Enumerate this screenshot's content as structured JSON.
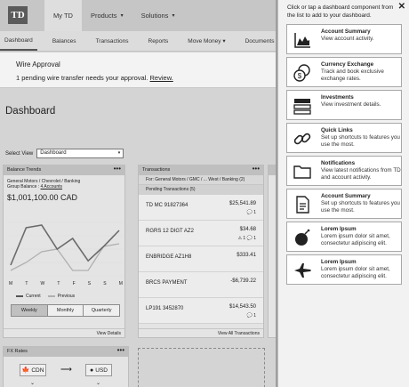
{
  "topbar": {
    "logo": "TD",
    "nav": [
      {
        "label": "My TD",
        "active": true,
        "caret": false
      },
      {
        "label": "Products",
        "active": false,
        "caret": true
      },
      {
        "label": "Solutions",
        "active": false,
        "caret": true
      }
    ],
    "caret_glyph": "▾"
  },
  "subnav": [
    "Dashboard",
    "Balances",
    "Transactions",
    "Reports",
    "Move Money",
    "Documents",
    "A"
  ],
  "move_money_caret": "▾",
  "alert": {
    "title": "Wire Approval",
    "message": "1 pending wire transfer needs your approval.",
    "link": "Review."
  },
  "page_title": "Dashboard",
  "select_view": {
    "label": "Select View",
    "value": "Dashboard"
  },
  "balance_trends": {
    "header": "Balance Trends",
    "account": "General Motors / Chevrolet / Banking",
    "group_prefix": "Group Balance :",
    "group_link": "4 Accounts",
    "balance": "$1,001,100.00 CAD",
    "days": [
      "M",
      "T",
      "W",
      "T",
      "F",
      "S",
      "S",
      "M"
    ],
    "legend_current": "Current",
    "legend_previous": "Previous",
    "tabs": [
      "Weekly",
      "Monthly",
      "Quarterly"
    ],
    "selected_tab": "Weekly",
    "footer": "View Details"
  },
  "transactions": {
    "header": "Transactions",
    "account_line": "For: General Motors / GMC / ... West / Banking (2)",
    "pending": "Pending Transactions (5)",
    "rows": [
      {
        "name": "TD MC 91827364",
        "amount": "$25,541.89",
        "icon": "💬 1"
      },
      {
        "name": "RGRS 12 DIGT AZ2",
        "amount": "$34.68",
        "icon": "⚠ 1 💬 1"
      },
      {
        "name": "ENBRIDGE AZ1H8",
        "amount": "$333.41",
        "icon": ""
      },
      {
        "name": "BRCS PAYMENT",
        "amount": "-$6,739.22",
        "icon": ""
      },
      {
        "name": "LP191 3452870",
        "amount": "$14,543.50",
        "icon": "💬 1"
      }
    ],
    "footer": "View All Transactions"
  },
  "fx_rates": {
    "header": "FX Rates",
    "from": "CDN",
    "to": "USD",
    "arrow": "⟶",
    "chevron": "⌄"
  },
  "sidebar": {
    "intro": "Click or tap a dashboard component from the list to add to your dashboard.",
    "close": "✕",
    "cards": [
      {
        "icon": "chart-icon",
        "title": "Account Summary",
        "desc": "View account activity."
      },
      {
        "icon": "currency-exchange-icon",
        "title": "Currency Exchange",
        "desc": "Track and book exclusive exchange rates."
      },
      {
        "icon": "investments-icon",
        "title": "Investments",
        "desc": "View investment details."
      },
      {
        "icon": "link-icon",
        "title": "Quick Links",
        "desc": "Set up shortcuts to features you use the most."
      },
      {
        "icon": "folder-icon",
        "title": "Notifications",
        "desc": "View latest notifications from TD and account activity."
      },
      {
        "icon": "document-icon",
        "title": "Account Summary",
        "desc": "Set up shortcuts to features you use the most."
      },
      {
        "icon": "bomb-icon",
        "title": "Lorem Ipsum",
        "desc": "Lorem ipsum dolor sit amet, consectetur adipiscing elit."
      },
      {
        "icon": "jet-icon",
        "title": "Lorem Ipsum",
        "desc": "Lorem ipsum dolor sit amet, consectetur adipiscing elit."
      }
    ]
  },
  "chart_data": {
    "type": "line",
    "categories": [
      "M",
      "T",
      "W",
      "T",
      "F",
      "S",
      "S",
      "M"
    ],
    "series": [
      {
        "name": "Current",
        "values": [
          2,
          9,
          9.5,
          5,
          7,
          2.8,
          5.5,
          8.5
        ]
      },
      {
        "name": "Previous",
        "values": [
          1,
          2.5,
          4.5,
          5,
          1,
          1,
          5.5,
          6
        ]
      }
    ],
    "ylim": [
      0,
      10
    ],
    "colors": {
      "current": "#6b6b6b",
      "previous": "#b0b0b0"
    }
  }
}
